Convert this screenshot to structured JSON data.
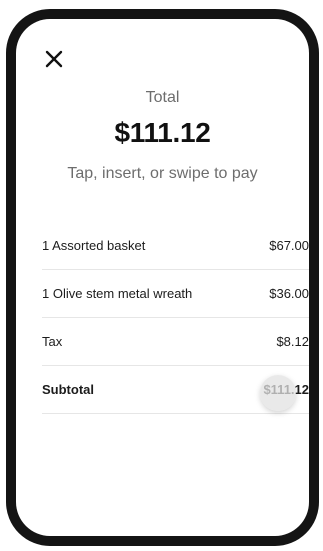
{
  "header": {
    "close_icon": "close-icon"
  },
  "summary": {
    "total_label": "Total",
    "total_amount": "$111.12",
    "instruction": "Tap, insert, or swipe to pay"
  },
  "line_items": [
    {
      "label": "1 Assorted basket",
      "amount": "$67.00"
    },
    {
      "label": "1 Olive stem metal wreath",
      "amount": "$36.00"
    },
    {
      "label": "Tax",
      "amount": "$8.12"
    },
    {
      "label": "Subtotal",
      "amount": "$111.12"
    }
  ],
  "colors": {
    "frame": "#141414",
    "text_primary": "#111111",
    "text_secondary": "#6d6d6d",
    "divider": "#e6e6e6"
  }
}
